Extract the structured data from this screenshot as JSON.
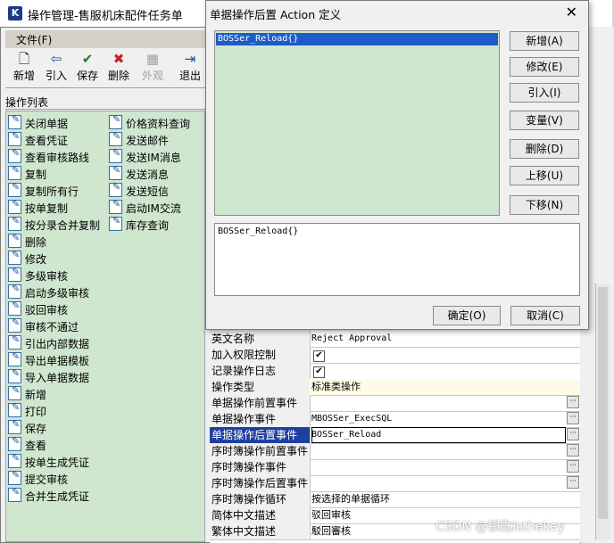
{
  "main_window": {
    "title": "操作管理-售服机床配件任务单",
    "menu": {
      "file": "文件(F)"
    },
    "toolbar": [
      {
        "label": "新增",
        "icon": "new-doc-icon",
        "glyph": "🗋",
        "disabled": false
      },
      {
        "label": "引入",
        "icon": "import-arrow-icon",
        "glyph": "⇦",
        "disabled": false
      },
      {
        "label": "保存",
        "icon": "save-icon",
        "glyph": "✔",
        "disabled": false
      },
      {
        "label": "删除",
        "icon": "delete-x-icon",
        "glyph": "✖",
        "disabled": false
      },
      {
        "label": "外观",
        "icon": "appearance-icon",
        "glyph": "▦",
        "disabled": true
      },
      {
        "label": "退出",
        "icon": "exit-icon",
        "glyph": "⇥",
        "disabled": false
      }
    ],
    "op_list_title": "操作列表",
    "op_col1": [
      "关闭单据",
      "查看凭证",
      "查看审核路线",
      "复制",
      "复制所有行",
      "按单复制",
      "按分录合并复制",
      "删除",
      "修改",
      "多级审核",
      "启动多级审核",
      "驳回审核",
      "审核不通过",
      "引出内部数据",
      "导出单据模板",
      "导入单据数据",
      "新增",
      "打印",
      "保存",
      "查看",
      "按单生成凭证",
      "提交审核",
      "合并生成凭证"
    ],
    "op_col2": [
      "价格资料查询",
      "发送邮件",
      "发送IM消息",
      "发送消息",
      "发送短信",
      "启动IM交流",
      "库存查询"
    ]
  },
  "properties": [
    {
      "key": "英文名称",
      "value": "Reject Approval",
      "type": "text"
    },
    {
      "key": "加入权限控制",
      "value": "✔",
      "type": "check"
    },
    {
      "key": "记录操作日志",
      "value": "✔",
      "type": "check"
    },
    {
      "key": "操作类型",
      "value": "标准类操作",
      "type": "yellow"
    },
    {
      "key": "单据操作前置事件",
      "value": "",
      "type": "button"
    },
    {
      "key": "单据操作事件",
      "value": "MBOSSer_ExecSQL",
      "type": "button"
    },
    {
      "key": "单据操作后置事件",
      "value": "BOSSer_Reload",
      "type": "button",
      "selected": true
    },
    {
      "key": "序时簿操作前置事件",
      "value": "",
      "type": "button"
    },
    {
      "key": "序时簿操作事件",
      "value": "",
      "type": "button"
    },
    {
      "key": "序时簿操作后置事件",
      "value": "",
      "type": "button"
    },
    {
      "key": "序时簿操作循环",
      "value": "按选择的单据循环",
      "type": "text"
    },
    {
      "key": "简体中文描述",
      "value": "驳回审核",
      "type": "text"
    },
    {
      "key": "繁体中文描述",
      "value": "駁回審核",
      "type": "text"
    }
  ],
  "dialog": {
    "title": "单据操作后置 Action 定义",
    "close": "✕",
    "selected_action": "BOSSer_Reload{}",
    "editor_text": "BOSSer_Reload{}",
    "buttons": [
      "新增(A)",
      "修改(E)",
      "引入(I)",
      "变量(V)",
      "删除(D)",
      "上移(U)",
      "下移(N)"
    ],
    "ok": "确定(O)",
    "cancel": "取消(C)"
  },
  "watermark": "CSDN @锁匙isthekey"
}
